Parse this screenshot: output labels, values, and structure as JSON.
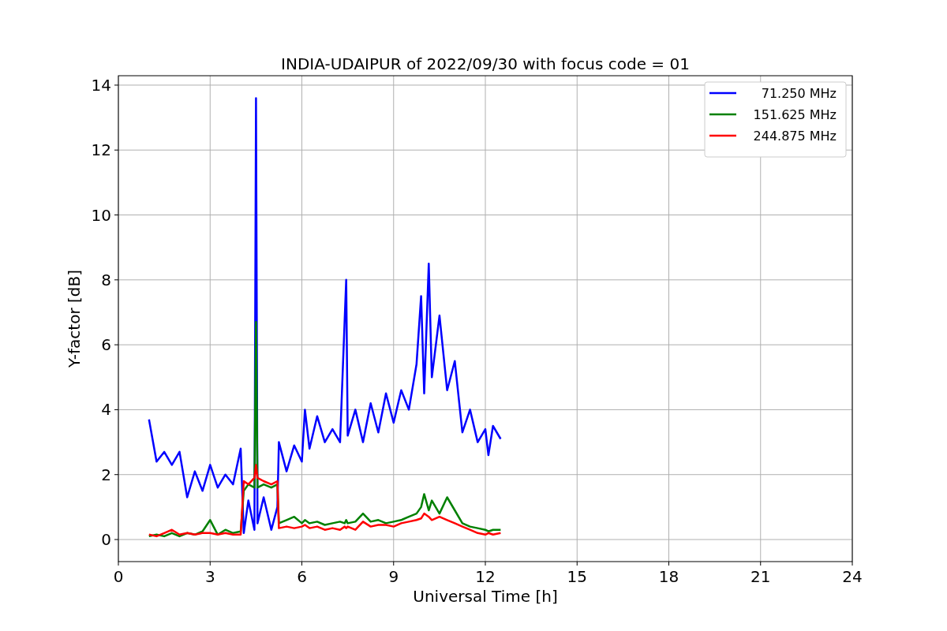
{
  "figure": {
    "chart_data": {
      "type": "line",
      "title": "INDIA-UDAIPUR of 2022/09/30 with focus code = 01",
      "xlabel": "Universal Time [h]",
      "ylabel": "Y-factor [dB]",
      "xlim": [
        0,
        24
      ],
      "ylim": [
        -0.68,
        14.29
      ],
      "grid": true,
      "legend": true,
      "xticks": [
        0,
        3,
        6,
        9,
        12,
        15,
        18,
        21,
        24
      ],
      "yticks": [
        0,
        2,
        4,
        6,
        8,
        10,
        12,
        14
      ],
      "x": [
        1,
        1.25,
        1.5,
        1.75,
        2,
        2.25,
        2.5,
        2.75,
        3,
        3.25,
        3.5,
        3.75,
        4,
        4.1,
        4.25,
        4.45,
        4.5,
        4.55,
        4.75,
        5,
        5.2,
        5.25,
        5.5,
        5.75,
        6,
        6.1,
        6.25,
        6.5,
        6.75,
        7,
        7.25,
        7.4,
        7.45,
        7.5,
        7.75,
        8,
        8.25,
        8.5,
        8.75,
        9,
        9.25,
        9.5,
        9.75,
        9.9,
        10,
        10.15,
        10.25,
        10.5,
        10.75,
        11,
        11.25,
        11.5,
        11.75,
        12,
        12.1,
        12.25,
        12.5
      ],
      "series": [
        {
          "name": " 71.250 MHz",
          "color": "#0000ff",
          "values": [
            3.7,
            2.4,
            2.7,
            2.3,
            2.7,
            1.3,
            2.1,
            1.5,
            2.3,
            1.6,
            2.0,
            1.7,
            2.8,
            0.2,
            1.2,
            0.3,
            13.6,
            0.5,
            1.3,
            0.3,
            1.0,
            3.0,
            2.1,
            2.9,
            2.4,
            4.0,
            2.8,
            3.8,
            3.0,
            3.4,
            3.0,
            6.8,
            8.0,
            3.2,
            4.0,
            3.0,
            4.2,
            3.3,
            4.5,
            3.6,
            4.6,
            4.0,
            5.4,
            7.5,
            4.5,
            8.5,
            5.0,
            6.9,
            4.6,
            5.5,
            3.3,
            4.0,
            3.0,
            3.4,
            2.6,
            3.5,
            3.1
          ]
        },
        {
          "name": "151.625 MHz",
          "color": "#008000",
          "values": [
            0.1,
            0.15,
            0.1,
            0.2,
            0.1,
            0.2,
            0.15,
            0.25,
            0.6,
            0.15,
            0.3,
            0.2,
            0.25,
            1.5,
            1.7,
            1.6,
            6.7,
            1.6,
            1.7,
            1.6,
            1.7,
            0.5,
            0.6,
            0.7,
            0.5,
            0.6,
            0.5,
            0.55,
            0.45,
            0.5,
            0.55,
            0.5,
            0.6,
            0.5,
            0.55,
            0.8,
            0.55,
            0.6,
            0.5,
            0.55,
            0.6,
            0.7,
            0.8,
            1.0,
            1.4,
            0.9,
            1.2,
            0.8,
            1.3,
            0.9,
            0.5,
            0.4,
            0.35,
            0.3,
            0.25,
            0.3,
            0.3
          ]
        },
        {
          "name": "244.875 MHz",
          "color": "#ff0000",
          "values": [
            0.15,
            0.1,
            0.2,
            0.3,
            0.15,
            0.2,
            0.15,
            0.2,
            0.2,
            0.15,
            0.2,
            0.15,
            0.15,
            1.8,
            1.7,
            1.9,
            2.3,
            1.9,
            1.8,
            1.7,
            1.8,
            0.35,
            0.4,
            0.35,
            0.4,
            0.45,
            0.35,
            0.4,
            0.3,
            0.35,
            0.3,
            0.4,
            0.35,
            0.4,
            0.3,
            0.55,
            0.4,
            0.45,
            0.45,
            0.4,
            0.5,
            0.55,
            0.6,
            0.65,
            0.8,
            0.7,
            0.6,
            0.7,
            0.6,
            0.5,
            0.4,
            0.3,
            0.2,
            0.15,
            0.2,
            0.15,
            0.2
          ]
        }
      ]
    }
  }
}
